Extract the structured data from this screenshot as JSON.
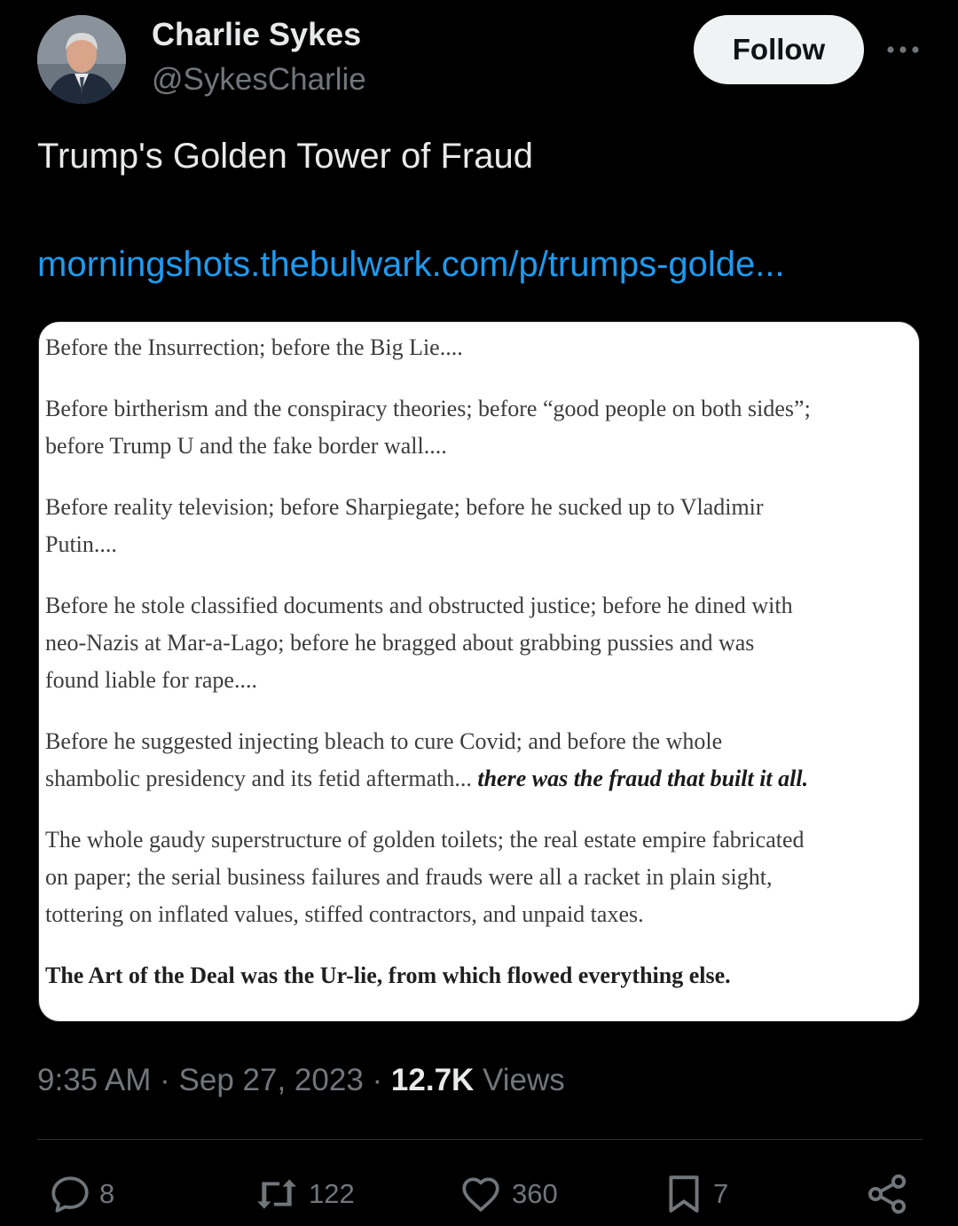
{
  "author": {
    "name": "Charlie Sykes",
    "handle": "@SykesCharlie"
  },
  "follow_label": "Follow",
  "tweet": {
    "text": "Trump's Golden Tower of Fraud",
    "link": "morningshots.thebulwark.com/p/trumps-golde..."
  },
  "image_text": {
    "p1": "Before the Insurrection; before the Big Lie....",
    "p2_line1": "Before birtherism and the conspiracy theories; before “good people on both sides”;",
    "p2_line2": "before Trump U and the fake border wall....",
    "p3_line1": "Before reality television; before Sharpiegate; before he sucked up to Vladimir",
    "p3_line2": "Putin....",
    "p4_line1": "Before he stole classified documents and obstructed justice; before he dined with",
    "p4_line2": "neo-Nazis at Mar-a-Lago; before he bragged about grabbing pussies and was",
    "p4_line3": "found liable for rape....",
    "p5_line1": "Before he suggested injecting bleach to cure Covid; and before the whole",
    "p5_line2": "shambolic presidency and its fetid aftermath... ",
    "p5_emphasis": "there was the fraud that built it all.",
    "p6_line1": "The whole gaudy superstructure of golden toilets; the real estate empire fabricated",
    "p6_line2": "on paper; the serial business failures and frauds were all a racket in plain sight,",
    "p6_line3": "tottering on inflated values, stiffed contractors, and unpaid taxes.",
    "p7": "The Art of the Deal was the Ur-lie, from which flowed everything else."
  },
  "meta": {
    "time": "9:35 AM",
    "separator": "·",
    "date": "Sep 27, 2023",
    "views_count": "12.7K",
    "views_label": "Views"
  },
  "actions": {
    "replies": "8",
    "reposts": "122",
    "likes": "360",
    "bookmarks": "7"
  },
  "colors": {
    "background": "#000000",
    "primary_text": "#e7e9ea",
    "secondary_text": "#71767b",
    "link": "#1d9bf0",
    "follow_bg": "#eff3f4",
    "divider": "#2f3336"
  },
  "icons": {
    "more": "more-icon",
    "reply": "reply-icon",
    "repost": "repost-icon",
    "like": "heart-icon",
    "bookmark": "bookmark-icon",
    "share": "share-icon"
  }
}
